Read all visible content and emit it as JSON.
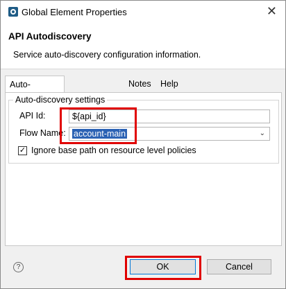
{
  "window": {
    "title": "Global Element Properties",
    "close_glyph": "✕"
  },
  "header": {
    "title": "API Autodiscovery",
    "subtitle": "Service auto-discovery configuration information."
  },
  "tabs": [
    {
      "label": "Auto-discovery configuration",
      "active": true
    },
    {
      "label": "Notes",
      "active": false
    },
    {
      "label": "Help",
      "active": false
    }
  ],
  "group": {
    "title": "Auto-discovery settings"
  },
  "fields": {
    "api_id": {
      "label": "API Id:",
      "value": "${api_id}"
    },
    "flow_name": {
      "label": "Flow Name:",
      "value": "account-main"
    }
  },
  "checkbox": {
    "label": "Ignore base path on resource level policies",
    "checked": true,
    "mark": "✓"
  },
  "buttons": {
    "ok": "OK",
    "cancel": "Cancel",
    "help_glyph": "?"
  },
  "icons": {
    "app": "mule-icon",
    "help": "help-icon",
    "dropdown": "chevron-down-icon"
  },
  "colors": {
    "highlight": "#e00000",
    "selection": "#2b62b4"
  }
}
